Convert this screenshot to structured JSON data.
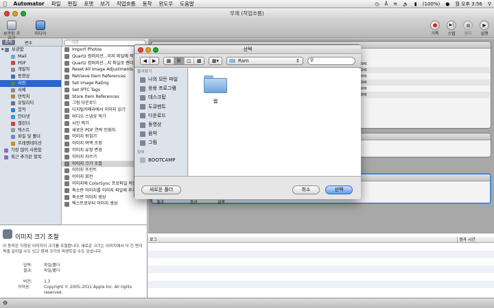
{
  "menubar": {
    "app": "Automator",
    "items": [
      "파일",
      "편집",
      "포맷",
      "보기",
      "작업흐름",
      "동작",
      "윈도우",
      "도움말"
    ],
    "battery": "(100%)",
    "clock": "월 오후 3:56"
  },
  "window": {
    "title": "무제 (작업흐름)"
  },
  "toolbar": {
    "hide_library": "보관함 가리기",
    "media": "미디어",
    "record": "기록",
    "step": "스텝",
    "stop": "정지",
    "run": "실행"
  },
  "library": {
    "tabs": [
      "동작",
      "변수"
    ],
    "search_placeholder": "이름",
    "categories": [
      {
        "label": "보관함",
        "color": "#6d7b8c",
        "indent": 0
      },
      {
        "label": "Mail",
        "color": "#7aa0d8",
        "indent": 1
      },
      {
        "label": "PDF",
        "color": "#c94a3d",
        "indent": 1
      },
      {
        "label": "개발자",
        "color": "#8a8a8a",
        "indent": 1
      },
      {
        "label": "동영상",
        "color": "#3a6fb0",
        "indent": 1
      },
      {
        "label": "사진",
        "color": "#4a8a4a",
        "indent": 1
      },
      {
        "label": "서체",
        "color": "#8b8b8b",
        "indent": 1
      },
      {
        "label": "연락처",
        "color": "#a98b5a",
        "indent": 1
      },
      {
        "label": "유틸리티",
        "color": "#6a6a8e",
        "indent": 1
      },
      {
        "label": "음악",
        "color": "#2a82c9",
        "indent": 1
      },
      {
        "label": "인터넷",
        "color": "#3a9ad9",
        "indent": 1
      },
      {
        "label": "캘린더",
        "color": "#c44",
        "indent": 1
      },
      {
        "label": "텍스트",
        "color": "#999",
        "indent": 1
      },
      {
        "label": "파일 및 폴더",
        "color": "#6a8ec4",
        "indent": 1
      },
      {
        "label": "프레젠테이션",
        "color": "#d08a30",
        "indent": 1
      },
      {
        "label": "가장 많이 사용함",
        "color": "#8a6ac4",
        "indent": 0
      },
      {
        "label": "최근 추가된 항목",
        "color": "#8a6ac4",
        "indent": 0
      }
    ],
    "selected_category": 5
  },
  "actions": {
    "items": [
      "Import Photos",
      "Quartz 컴퍼지션...미지 파일에 적용",
      "Quartz 컴퍼지션...지 파일로 렌더",
      "Reset All Image Adjustments",
      "Retrieve Item References",
      "Set Image Rating",
      "Set IPTC Tags",
      "Store Item References",
      "그림 다운로드",
      "디지털카메라에서 이미지 읽기",
      "비디오 스냅샷 찍기",
      "사진 찍기",
      "새로운 PDF 연락 인화지",
      "이미지 뒤집기",
      "이미지 여백 조정",
      "이미지 유형 변경",
      "이미지 자르기",
      "이미지 크기 조절",
      "이미지 프린트",
      "이미지 회전",
      "이미지에 ColorSync 프로파일 적용",
      "축소판 이미지를 이미지 파일에 추가",
      "축소판 이미지 생성",
      "텍스트로부터 이미지 생성"
    ],
    "selected": 17
  },
  "description": {
    "title": "이미지 크기 조절",
    "body": "이 동작은 지정된 이미지의 크기를 조절합니다. 새로운 크기는 이미지에서 더 긴 면의 픽셀 길이일 수도 있고 원래 크기의 퍼센트일 수도 있습니다.",
    "input_label": "입력:",
    "input_value": "파일/폴더",
    "result_label": "결과:",
    "result_value": "파일/폴더",
    "version_label": "버전:",
    "version_value": "1.3",
    "copyright_label": "저작권:",
    "copyright_value": "Copyright © 2005–2011 Apple Inc. All rights reserved."
  },
  "workflow": {
    "file_rows": [
      "jpg",
      "jpg",
      "jpg",
      "jpg",
      "jpg",
      "jpg"
    ],
    "options_tabs": [
      "결과",
      "옵션",
      "설명"
    ]
  },
  "log": {
    "col_log": "로그",
    "col_time": "경과 시간"
  },
  "dialog": {
    "title": "선택",
    "path": "Ram",
    "sidebar": {
      "favorites_header": "즐겨찾기",
      "favorites": [
        {
          "label": "나의 모든 파일",
          "icon": "all-files-icon"
        },
        {
          "label": "응용 프로그램",
          "icon": "applications-icon"
        },
        {
          "label": "데스크탑",
          "icon": "desktop-icon"
        },
        {
          "label": "도큐멘트",
          "icon": "documents-icon"
        },
        {
          "label": "다운로드",
          "icon": "downloads-icon"
        },
        {
          "label": "동영상",
          "icon": "movies-icon"
        },
        {
          "label": "음악",
          "icon": "music-icon"
        },
        {
          "label": "그림",
          "icon": "pictures-icon"
        }
      ],
      "devices_header": "장비",
      "devices": [
        {
          "label": "BOOTCAMP",
          "icon": "drive-icon"
        }
      ]
    },
    "files": [
      {
        "label": "웹",
        "icon": "folder-icon"
      }
    ],
    "new_folder": "새로운 폴더",
    "cancel": "취소",
    "choose": "선택"
  }
}
